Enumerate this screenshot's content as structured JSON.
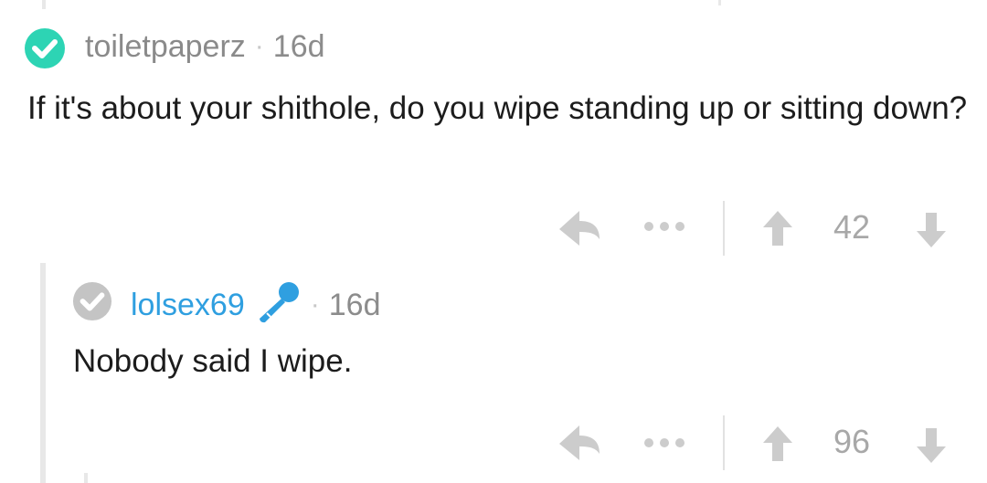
{
  "colors": {
    "verified_avatar": "#2dd4b4",
    "default_avatar": "#c4c4c4",
    "username_op": "#8a8a8a",
    "username_link": "#2f9fe0",
    "mic_icon": "#2f9fe0",
    "action_icon": "#cccccc"
  },
  "comments": [
    {
      "avatar_icon": "check-circle-icon",
      "username": "toiletpaperz",
      "separator": "·",
      "age": "16d",
      "body": "If it's about your shithole, do you wipe standing up or sitting down?",
      "score": "42"
    },
    {
      "avatar_icon": "check-circle-icon",
      "username": "lolsex69",
      "flair_icon": "microphone-icon",
      "separator": "·",
      "age": "16d",
      "body": "Nobody said I wipe.",
      "score": "96"
    }
  ],
  "action_icons": [
    "reply-icon",
    "more-icon",
    "upvote-icon",
    "downvote-icon"
  ]
}
